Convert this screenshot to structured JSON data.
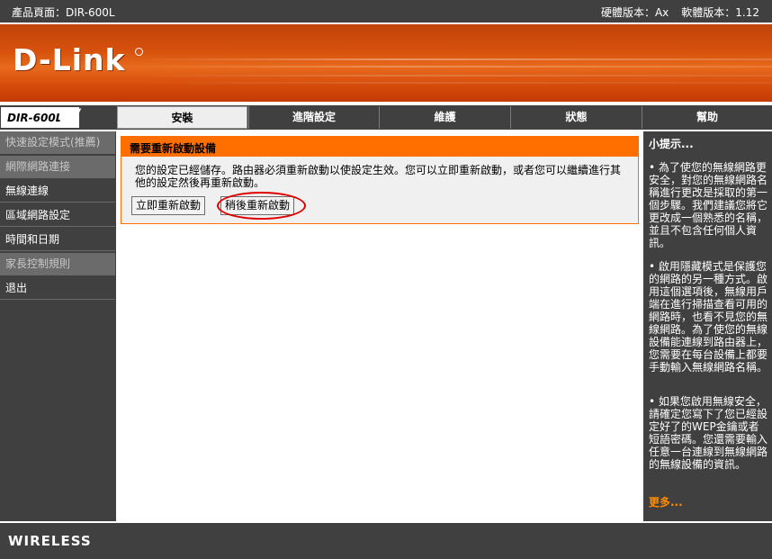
{
  "topbar": {
    "product_page": "產品頁面：DIR-600L",
    "hardware_version": "硬體版本：Ax",
    "firmware_version": "軟體版本：1.12"
  },
  "brand": {
    "logo_text": "D-Link",
    "model": "DIR-600L"
  },
  "nav": {
    "tabs": [
      "安裝",
      "進階設定",
      "維護",
      "狀態",
      "幫助"
    ],
    "active_tab": "安裝"
  },
  "sidebar": {
    "items": [
      {
        "label": "快速設定模式(推薦)",
        "enabled": false
      },
      {
        "label": "網際網路連接",
        "enabled": false
      },
      {
        "label": "無線連線",
        "enabled": true
      },
      {
        "label": "區域網路設定",
        "enabled": true
      },
      {
        "label": "時間和日期",
        "enabled": true
      },
      {
        "label": "家長控制規則",
        "enabled": false
      },
      {
        "label": "退出",
        "enabled": true
      }
    ]
  },
  "main": {
    "panel_title": "需要重新啟動設備",
    "message": "您的設定已經儲存。路由器必須重新啟動以使設定生效。您可以立即重新啟動，或者您可以繼續進行其他的設定然後再重新啟動。",
    "reboot_now_label": "立即重新啟動",
    "reboot_later_label": "稍後重新啟動"
  },
  "hints": {
    "title": "小提示...",
    "tips": [
      "• 為了使您的無線網路更安全，對您的無線網路名稱進行更改是採取的第一個步驟。我們建議您將它更改成一個熟悉的名稱，並且不包含任何個人資訊。",
      "• 啟用隱藏模式是保護您的網路的另一種方式。啟用這個選項後，無線用戶端在進行掃描查看可用的網路時，也看不見您的無線網路。為了使您的無線設備能連線到路由器上，您需要在每台設備上都要手動輸入無線網路名稱。",
      "• 如果您啟用無線安全，請確定您寫下了您已經設定好了的WEP金鑰或者短語密碼。您還需要輸入任意一台連線到無線網路的無線設備的資訊。"
    ],
    "more": "更多..."
  },
  "footer": {
    "label": "WIRELESS"
  },
  "colors": {
    "accent": "#ff6f00",
    "dark": "#404040",
    "highlight_circle": "#e00000"
  }
}
